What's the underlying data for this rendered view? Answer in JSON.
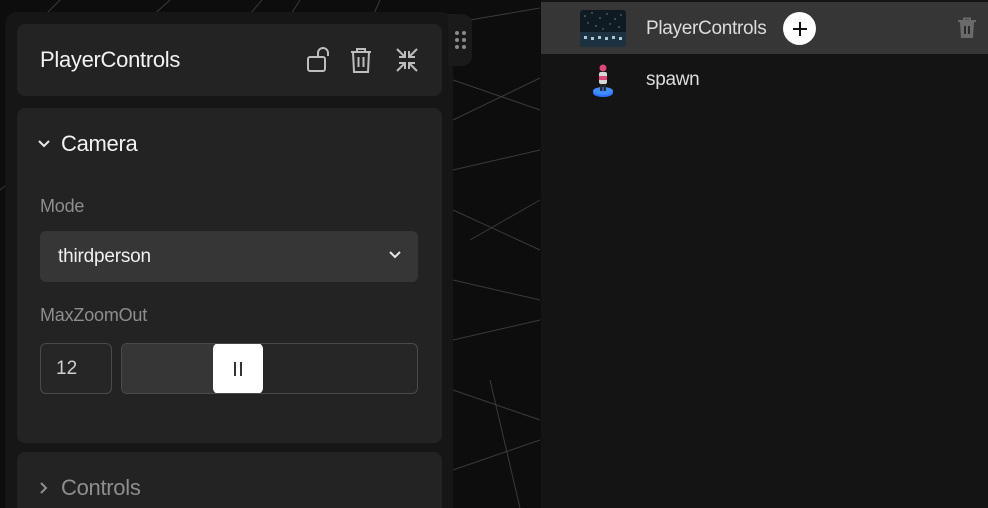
{
  "inspector": {
    "title": "PlayerControls",
    "camera_section": {
      "title": "Camera",
      "mode_label": "Mode",
      "mode_value": "thirdperson",
      "zoom_label": "MaxZoomOut",
      "zoom_value": "12",
      "zoom_slider_fraction": 0.37
    },
    "controls_section": {
      "title": "Controls"
    }
  },
  "hierarchy": {
    "items": [
      {
        "label": "PlayerControls",
        "selected": true
      },
      {
        "label": "spawn",
        "selected": false
      }
    ]
  },
  "icons": {
    "header": [
      "unlock-icon",
      "trash-icon",
      "collapse-icon"
    ],
    "chevron": "chevron-down-icon"
  },
  "colors": {
    "panel": "#232323",
    "selected_row": "#363636",
    "accent_blue": "#2f6fff"
  }
}
